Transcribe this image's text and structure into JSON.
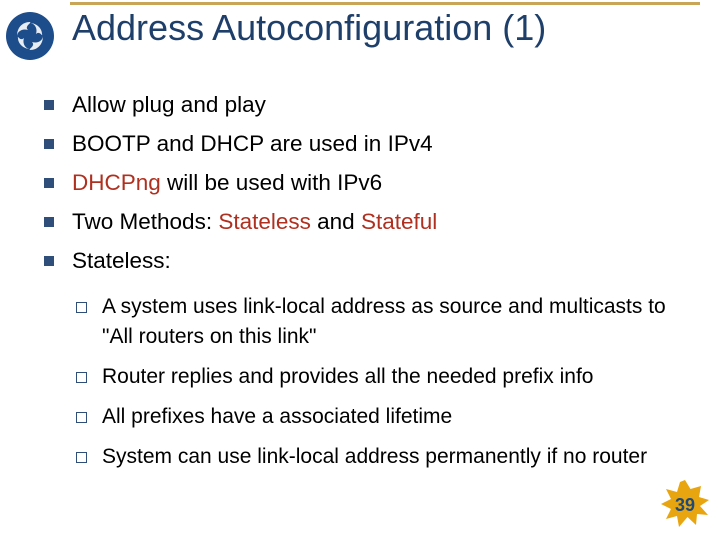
{
  "slide": {
    "title": "Address Autoconfiguration (1)",
    "bullets": [
      {
        "text": "Allow plug and play"
      },
      {
        "text": "BOOTP and DHCP are used in IPv4"
      },
      {
        "text_pre": "",
        "em1": "DHCPng",
        "text_mid": " will be used with IPv6"
      },
      {
        "text_pre": "Two Methods: ",
        "em1": "Stateless",
        "text_mid": " and ",
        "em2": "Stateful"
      },
      {
        "text": "Stateless:"
      }
    ],
    "sub_bullets": [
      "A system uses link-local address as source and multicasts to \"All routers on this link\"",
      "Router replies and provides all the needed prefix info",
      "All prefixes have a associated lifetime",
      "System can use link-local address permanently if no router"
    ],
    "page_number": "39"
  }
}
